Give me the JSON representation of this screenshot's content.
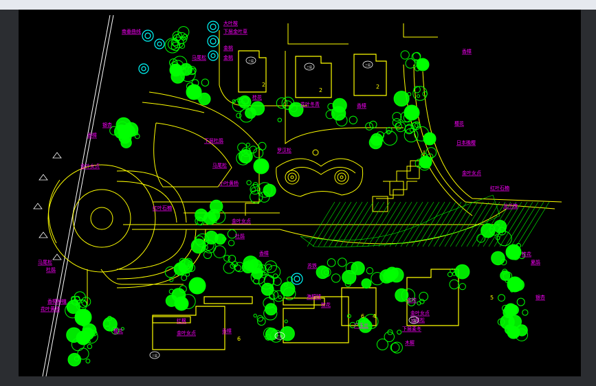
{
  "drawing": {
    "colors": {
      "background": "#000000",
      "frame": "#e6e9ef",
      "linework": "#ffff00",
      "vegetation": "#00ff00",
      "label": "#ff00ff",
      "water_feature": "#00ffff",
      "outline": "#ffffff"
    },
    "building_numbers": [
      "2",
      "2",
      "2",
      "6",
      "5",
      "6",
      "4"
    ],
    "building_tags": [
      "三层",
      "三层",
      "三层",
      "三层",
      "三层",
      "三层"
    ],
    "labels": [
      "南垂曲线",
      "大叶桉",
      "下层金叶草",
      "金桃",
      "金桃",
      "马尾松",
      "桂花",
      "花叶冬青",
      "香樟",
      "银杏",
      "香樟",
      "下层杜鹃",
      "金叶女贞",
      "罗汉松",
      "马尾松",
      "小叶黄杨",
      "红叶石楠",
      "金叶女贞",
      "杜鹃",
      "香樟",
      "苏铁",
      "马尾松",
      "杜鹃",
      "香樟种植",
      "花叶黄杨",
      "樱花",
      "红枫",
      "金叶女贞",
      "香樟",
      "海桐球",
      "桂花",
      "广玉兰",
      "下层麦冬",
      "香樟",
      "樱花",
      "日本晚樱",
      "金叶女贞",
      "红叶石楠",
      "龙爪槐",
      "桂花",
      "夏鹃",
      "银杏",
      "木樨",
      "金桂",
      "金叶女贞",
      "马尾松"
    ]
  }
}
